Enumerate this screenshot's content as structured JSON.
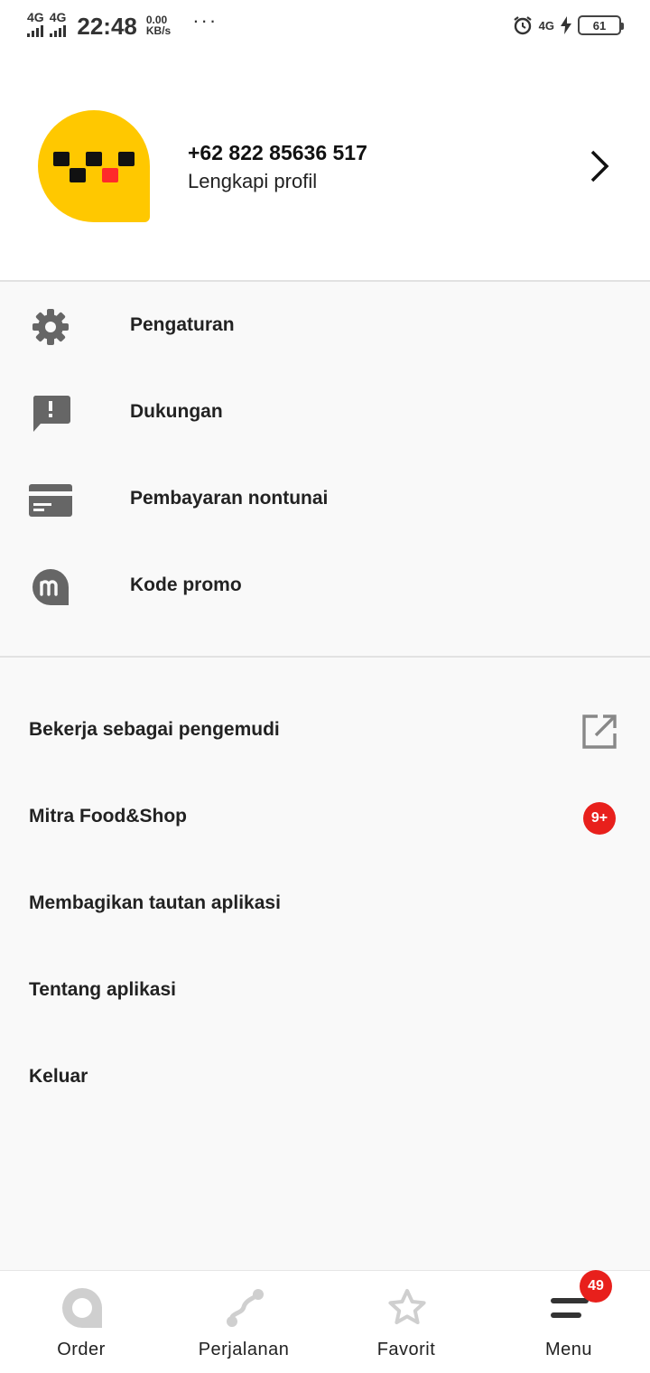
{
  "status_bar": {
    "network1": "4G",
    "network2": "4G",
    "time": "22:48",
    "speed_value": "0.00",
    "speed_unit": "KB/s",
    "more": "···",
    "right_network": "4G",
    "battery": "61"
  },
  "profile": {
    "phone": "+62 822 85636 517",
    "subtitle": "Lengkapi profil"
  },
  "menu_primary": [
    {
      "label": "Pengaturan",
      "icon": "gear-icon"
    },
    {
      "label": "Dukungan",
      "icon": "support-chat-icon"
    },
    {
      "label": "Pembayaran nontunai",
      "icon": "card-icon"
    },
    {
      "label": "Kode promo",
      "icon": "promo-icon"
    }
  ],
  "menu_secondary": [
    {
      "label": "Bekerja sebagai pengemudi",
      "icon": "external-link-icon"
    },
    {
      "label": "Mitra Food&Shop",
      "badge": "9+"
    },
    {
      "label": "Membagikan tautan aplikasi"
    },
    {
      "label": "Tentang aplikasi"
    },
    {
      "label": "Keluar"
    }
  ],
  "bottom_nav": [
    {
      "label": "Order",
      "icon": "order-icon"
    },
    {
      "label": "Perjalanan",
      "icon": "route-icon"
    },
    {
      "label": "Favorit",
      "icon": "star-icon"
    },
    {
      "label": "Menu",
      "icon": "menu-icon",
      "badge": "49"
    }
  ],
  "colors": {
    "accent": "#ffc800",
    "badge": "#e8201c",
    "icon_gray": "#666666",
    "nav_inactive": "#cfcfcf"
  }
}
